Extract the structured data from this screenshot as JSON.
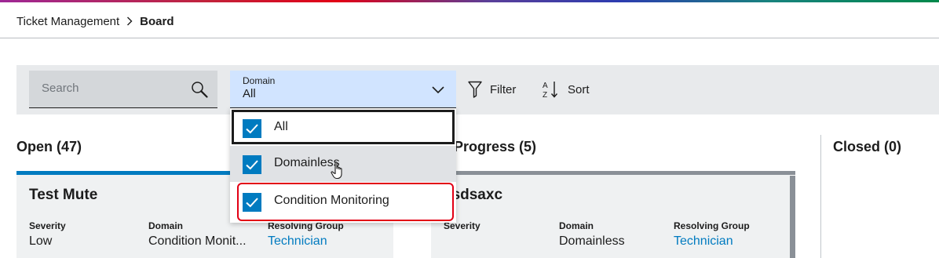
{
  "header": {
    "breadcrumb": [
      "Ticket Management",
      "Board"
    ]
  },
  "toolbar": {
    "search": {
      "placeholder": "Search",
      "icon": "search-icon"
    },
    "domain_filter": {
      "label": "Domain",
      "value": "All",
      "icon": "chevron-down-icon"
    },
    "filter_label": "Filter",
    "sort_label": "Sort"
  },
  "domain_dropdown": {
    "options": [
      {
        "label": "All",
        "checked": true,
        "focused": true
      },
      {
        "label": "Domainless",
        "checked": true,
        "hovered": true
      },
      {
        "label": "Condition Monitoring",
        "checked": true,
        "highlighted": true
      }
    ]
  },
  "columns": [
    {
      "title": "Open (47)",
      "accent_color": "#007bc0",
      "card": {
        "title": "Test Mute",
        "fields": [
          {
            "label": "Severity",
            "value": "Low"
          },
          {
            "label": "Domain",
            "value": "Condition Monit..."
          },
          {
            "label": "Resolving Group",
            "value": "Technician"
          }
        ]
      }
    },
    {
      "title": "Progress (5)",
      "accent_color": "#8a9097",
      "card": {
        "title": "xsdsaxc",
        "fields": [
          {
            "label": "Severity",
            "value": ""
          },
          {
            "label": "Domain",
            "value": "Domainless"
          },
          {
            "label": "Resolving Group",
            "value": "Technician"
          }
        ]
      }
    },
    {
      "title": "Closed (0)"
    }
  ],
  "colors": {
    "primary": "#007bc0",
    "select_bg": "#d1e4ff",
    "highlight": "#e20015"
  }
}
